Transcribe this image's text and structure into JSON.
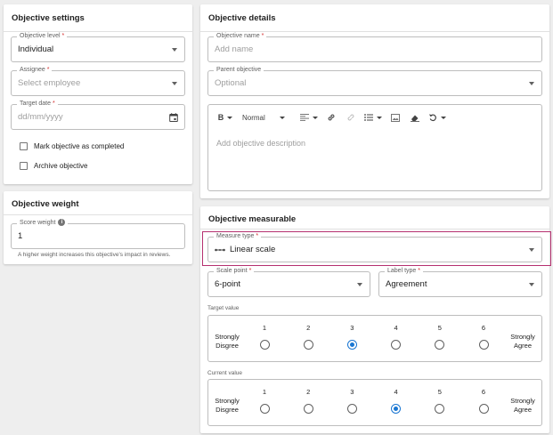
{
  "settings": {
    "title": "Objective settings",
    "level": {
      "label": "Objective level",
      "value": "Individual"
    },
    "assignee": {
      "label": "Assignee",
      "placeholder": "Select employee"
    },
    "target_date": {
      "label": "Target date",
      "placeholder": "dd/mm/yyyy"
    },
    "mark_completed": "Mark objective as completed",
    "archive": "Archive objective",
    "required_mark": "*"
  },
  "weight": {
    "title": "Objective weight",
    "score_label": "Score weight",
    "score_value": "1",
    "info_glyph": "i",
    "help": "A higher weight increases this objective's impact in reviews."
  },
  "details": {
    "title": "Objective details",
    "name": {
      "label": "Objective name",
      "placeholder": "Add name"
    },
    "parent": {
      "label": "Parent objective",
      "placeholder": "Optional"
    },
    "toolbar": {
      "bold": "B",
      "style": "Normal"
    },
    "description_placeholder": "Add objective description"
  },
  "measurable": {
    "title": "Objective measurable",
    "measure_type": {
      "label": "Measure type",
      "value": "Linear scale",
      "icon": "linear-scale-icon"
    },
    "scale_point": {
      "label": "Scale point",
      "value": "6-point"
    },
    "label_type": {
      "label": "Label type",
      "value": "Agreement"
    },
    "target": {
      "label": "Target value",
      "points": [
        "1",
        "2",
        "3",
        "4",
        "5",
        "6"
      ],
      "selected": 3,
      "low": "Strongly Disgree",
      "high": "Strongly Agree"
    },
    "current": {
      "label": "Current value",
      "points": [
        "1",
        "2",
        "3",
        "4",
        "5",
        "6"
      ],
      "selected": 4,
      "low": "Strongly Disgree",
      "high": "Strongly Agree"
    }
  },
  "colors": {
    "accent": "#1976d2",
    "highlight": "#b5306f",
    "required": "#d32f2f"
  }
}
